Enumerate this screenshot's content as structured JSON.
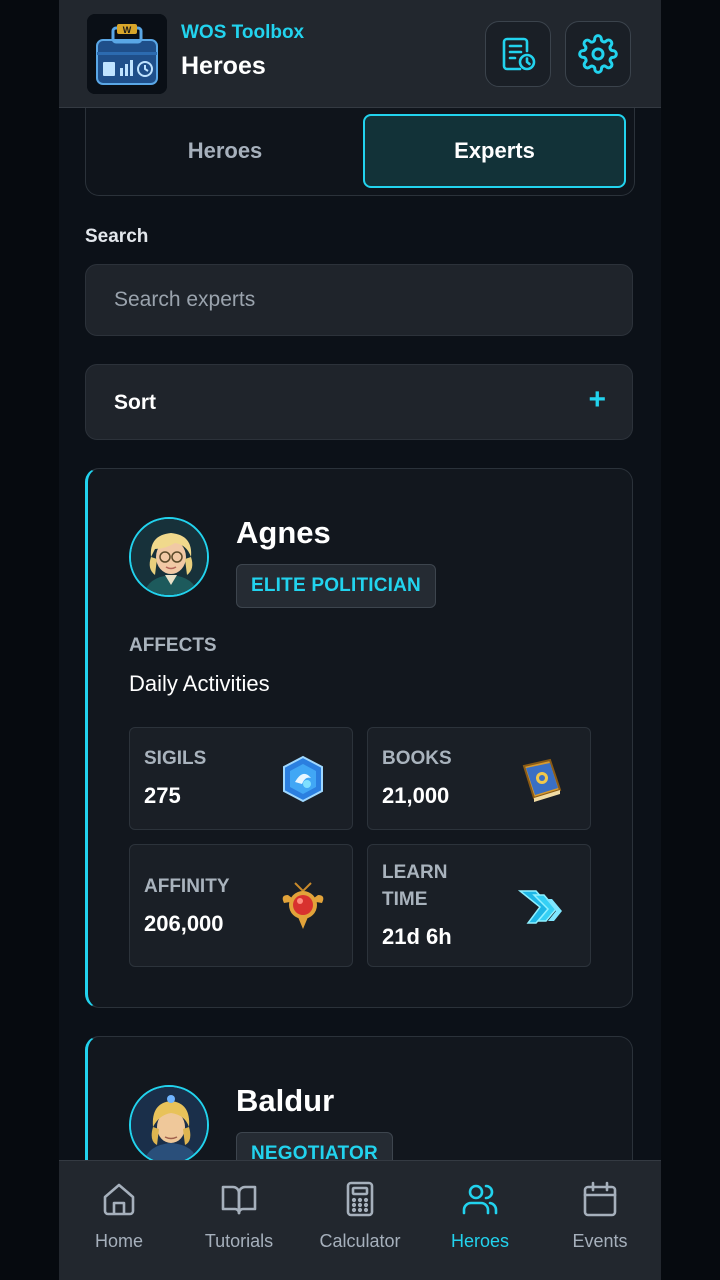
{
  "header": {
    "app_name": "WOS Toolbox",
    "title": "Heroes"
  },
  "tabs": [
    {
      "label": "Heroes",
      "active": false
    },
    {
      "label": "Experts",
      "active": true
    }
  ],
  "search": {
    "label": "Search",
    "placeholder": "Search experts",
    "value": ""
  },
  "sort": {
    "label": "Sort",
    "toggle_icon": "plus-icon"
  },
  "experts": [
    {
      "name": "Agnes",
      "role": "ELITE POLITICIAN",
      "affects_label": "AFFECTS",
      "affects": "Daily Activities",
      "stats": {
        "sigils": {
          "label": "SIGILS",
          "value": "275",
          "icon": "sigil-icon"
        },
        "books": {
          "label": "BOOKS",
          "value": "21,000",
          "icon": "book-icon"
        },
        "affinity": {
          "label": "AFFINITY",
          "value": "206,000",
          "icon": "affinity-medal-icon"
        },
        "learn_time": {
          "label_line1": "LEARN",
          "label_line2": "TIME",
          "value": "21d 6h",
          "icon": "learn-time-arrows-icon"
        }
      }
    },
    {
      "name": "Baldur",
      "role": "NEGOTIATOR"
    }
  ],
  "bottom_nav": [
    {
      "label": "Home",
      "icon": "home-icon",
      "active": false
    },
    {
      "label": "Tutorials",
      "icon": "book-open-icon",
      "active": false
    },
    {
      "label": "Calculator",
      "icon": "calculator-icon",
      "active": false
    },
    {
      "label": "Heroes",
      "icon": "users-icon",
      "active": true
    },
    {
      "label": "Events",
      "icon": "calendar-icon",
      "active": false
    }
  ],
  "colors": {
    "accent": "#22d3ee",
    "background": "#0c1118",
    "surface": "#1f242b",
    "text_muted": "#a9b3bd"
  }
}
